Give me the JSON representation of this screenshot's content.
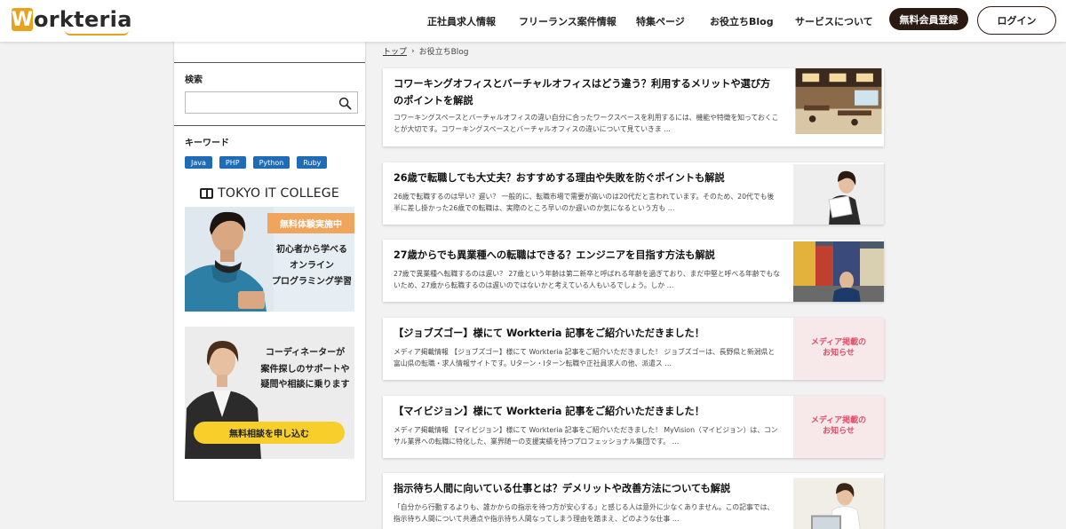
{
  "header": {
    "logo_prefix": "W",
    "logo_rest": "orkteria",
    "nav": [
      {
        "label": "正社員求人情報"
      },
      {
        "label": "フリーランス案件情報"
      },
      {
        "label": "特集ページ"
      },
      {
        "label": "お役立ちBlog"
      },
      {
        "label": "サービスについて"
      }
    ],
    "register_label": "無料会員登録",
    "login_label": "ログイン"
  },
  "sidebar": {
    "search_label": "検索",
    "search_placeholder": "",
    "keyword_label": "キーワード",
    "tags": [
      "Java",
      "PHP",
      "Python",
      "Ruby"
    ],
    "banner1": {
      "school": "TOKYO IT COLLEGE",
      "badge": "無料体験実施中",
      "lines": [
        "初心者から学べる",
        "オンライン",
        "プログラミング学習"
      ]
    },
    "banner2": {
      "lines": [
        "コーディネーターが",
        "案件探しのサポートや",
        "疑問や相談に乗ります"
      ],
      "button": "無料相談を申し込む"
    }
  },
  "breadcrumb": {
    "home": "トップ",
    "separator": "›",
    "current": "お役立ちBlog"
  },
  "articles": [
    {
      "title": "コワーキングオフィスとバーチャルオフィスはどう違う？利用するメリットや選び方のポイントを解説",
      "excerpt": "コワーキングスペースとバーチャルオフィスの違い自分に合ったワークスペースを利用するには、機能や特徴を知っておくことが大切です。コワーキングスペースとバーチャルオフィスの違いについて見ていきま …",
      "thumb": "office"
    },
    {
      "title": "26歳で転職しても大丈夫？おすすめする理由や失敗を防ぐポイントも解説",
      "excerpt": "26歳で転職するのは早い？遅い？ 一般的に、転職市場で需要が高いのは20代だと言われています。そのため、20代でも後半に差し掛かった26歳での転職は、実際のところ早いのか遅いのか気になるという方も …",
      "thumb": "worker"
    },
    {
      "title": "27歳からでも異業種への転職はできる？エンジニアを目指す方法も解説",
      "excerpt": "27歳で異業種へ転職するのは遅い？ 27歳という年齢は第二新卒と呼ばれる年齢を過ぎており、まだ中堅と呼べる年齢でもないため、27歳から転職するのは遅いのではないかと考えている人もいるでしょう。しか …",
      "thumb": "city"
    },
    {
      "title": "【ジョブズゴー】様にて Workteria 記事をご紹介いただきました！",
      "excerpt": "メディア掲載情報 【ジョブズゴー】様にて Workteria 記事をご紹介いただきました！ ジョブズゴーは、長野県と新潟県と富山県の転職・求人情報サイトです。Uターン・Iターン転職や正社員求人の他、派遣ス …",
      "thumb": "media",
      "thumb_text": [
        "メディア掲載の",
        "お知らせ"
      ]
    },
    {
      "title": "【マイビジョン】様にて Workteria 記事をご紹介いただきました！",
      "excerpt": "メディア掲載情報 【マイビジョン】様にて Workteria 記事をご紹介いただきました！ MyVision（マイビジョン）は、コンサル業界への転職に特化した、業界随一の支援実績を持つプロフェッショナル集団です。 …",
      "thumb": "media",
      "thumb_text": [
        "メディア掲載の",
        "お知らせ"
      ]
    },
    {
      "title": "指示待ち人間に向いている仕事とは？デメリットや改善方法についても解説",
      "excerpt": "「自分から行動するよりも、誰かからの指示を待つ方が安心する」と感じる人は意外に少なくありません。この記事では、指示待ち人間について共通点や指示待ち人間なってしまう理由を踏まえ、どのような仕事 …",
      "thumb": "laptop"
    }
  ],
  "colors": {
    "accent": "#e9a21c",
    "register_bg": "#2b1a12",
    "tag_bg": "#1e6bb8",
    "consult_button": "#f7ce2a",
    "badge_orange": "#f0a55d"
  }
}
